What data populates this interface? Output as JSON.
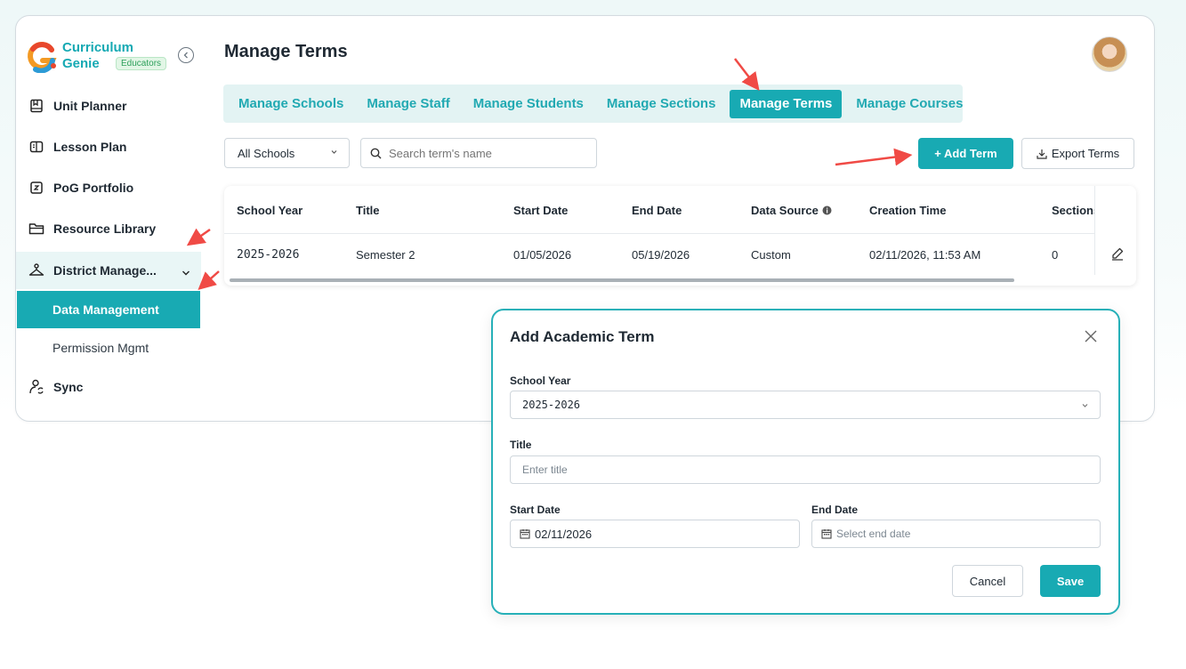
{
  "brand": {
    "line1": "Curriculum",
    "line2": "Genie",
    "badge": "Educators",
    "accent": "#18aab3"
  },
  "sidebar": {
    "items": [
      {
        "label": "Unit Planner",
        "icon": "book-icon"
      },
      {
        "label": "Lesson Plan",
        "icon": "lesson-icon"
      },
      {
        "label": "PoG Portfolio",
        "icon": "portfolio-icon"
      },
      {
        "label": "Resource Library",
        "icon": "folder-icon"
      },
      {
        "label": "District Manage...",
        "icon": "hanger-icon",
        "expanded": true
      },
      {
        "label": "Sync",
        "icon": "sync-user-icon"
      }
    ],
    "subitems": [
      {
        "label": "Data Management",
        "selected": true
      },
      {
        "label": "Permission Mgmt",
        "selected": false
      }
    ]
  },
  "header": {
    "title": "Manage Terms"
  },
  "tabs": [
    {
      "label": "Manage Schools",
      "active": false
    },
    {
      "label": "Manage Staff",
      "active": false
    },
    {
      "label": "Manage Students",
      "active": false
    },
    {
      "label": "Manage Sections",
      "active": false
    },
    {
      "label": "Manage Terms",
      "active": true
    },
    {
      "label": "Manage Courses",
      "active": false
    }
  ],
  "toolbar": {
    "school_filter": "All Schools",
    "search_placeholder": "Search term's name",
    "add_label": "+ Add Term",
    "export_label": "Export Terms"
  },
  "table": {
    "columns": [
      "School Year",
      "Title",
      "Start Date",
      "End Date",
      "Data Source",
      "Creation Time",
      "Sections"
    ],
    "rows": [
      {
        "school_year": "2025-2026",
        "title": "Semester 2",
        "start": "01/05/2026",
        "end": "05/19/2026",
        "source": "Custom",
        "created": "02/11/2026, 11:53 AM",
        "sections": "0"
      }
    ]
  },
  "modal": {
    "title": "Add Academic Term",
    "school_year_label": "School Year",
    "school_year_value": "2025-2026",
    "title_label": "Title",
    "title_placeholder": "Enter title",
    "start_label": "Start Date",
    "start_value": "02/11/2026",
    "end_label": "End Date",
    "end_placeholder": "Select end date",
    "cancel_label": "Cancel",
    "save_label": "Save"
  }
}
